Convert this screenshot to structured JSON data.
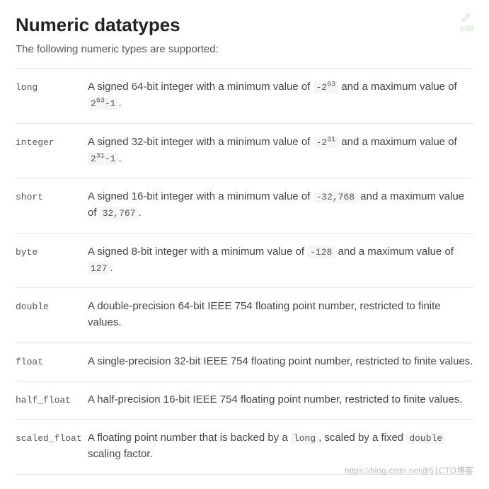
{
  "header": {
    "title": "Numeric datatypes",
    "edit_label": "edit"
  },
  "intro": "The following numeric types are supported:",
  "types": [
    {
      "name": "long",
      "desc_parts": [
        "A signed 64-bit integer with a minimum value of ",
        "-2",
        "63",
        " and a maximum value of ",
        "2",
        "63",
        "-1",
        "."
      ],
      "has_sup": true
    },
    {
      "name": "integer",
      "desc_parts": [
        "A signed 32-bit integer with a minimum value of ",
        "-2",
        "31",
        " and a maximum value of ",
        "2",
        "31",
        "-1",
        "."
      ],
      "has_sup": true
    },
    {
      "name": "short",
      "desc_plain": [
        "A signed 16-bit integer with a minimum value of ",
        "-32,768",
        " and a maximum value of ",
        "32,767",
        "."
      ]
    },
    {
      "name": "byte",
      "desc_plain": [
        "A signed 8-bit integer with a minimum value of ",
        "-128",
        " and a maximum value of ",
        "127",
        "."
      ]
    },
    {
      "name": "double",
      "desc_text": "A double-precision 64-bit IEEE 754 floating point number, restricted to finite values."
    },
    {
      "name": "float",
      "desc_text": "A single-precision 32-bit IEEE 754 floating point number, restricted to finite values."
    },
    {
      "name": "half_float",
      "desc_text": "A half-precision 16-bit IEEE 754 floating point number, restricted to finite values."
    },
    {
      "name": "scaled_float",
      "desc_scaled": [
        "A floating point number that is backed by a ",
        "long",
        ", scaled by a fixed ",
        "double",
        " scaling factor."
      ]
    }
  ],
  "watermark": "https://blog.csdn.net@51CTO博客"
}
